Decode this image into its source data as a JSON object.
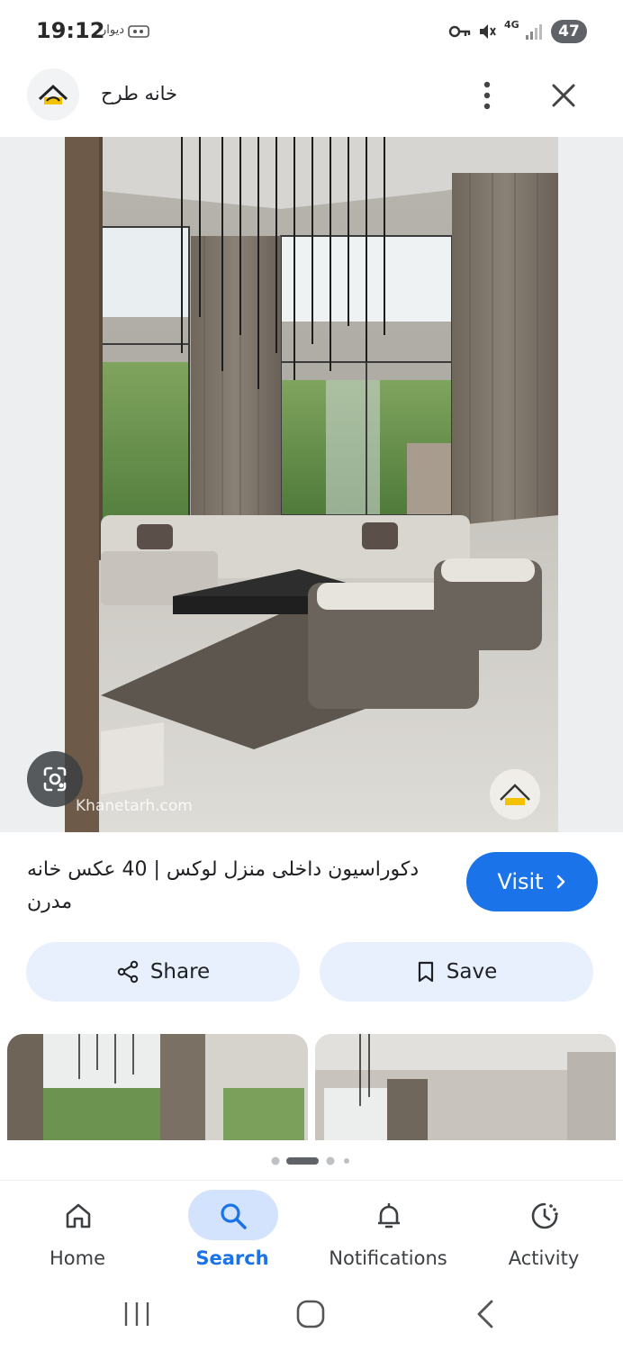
{
  "status_bar": {
    "time": "19:12",
    "app_label": "دیوار",
    "network": "4G",
    "battery": "47",
    "icons": [
      "key-icon",
      "mute-icon",
      "signal-icon"
    ]
  },
  "app_bar": {
    "site_name": "خانه طرح",
    "icons": [
      "site-logo-icon",
      "more-vert-icon",
      "close-icon"
    ]
  },
  "image": {
    "watermark": "Khanetarh.com"
  },
  "caption": "دکوراسیون داخلی منزل لوکس | 40 عکس خانه مدرن",
  "actions": {
    "visit_label": "Visit",
    "share_label": "Share",
    "save_label": "Save"
  },
  "bottom_nav": {
    "items": [
      {
        "label": "Home",
        "icon": "home-icon"
      },
      {
        "label": "Search",
        "icon": "search-icon",
        "active": true
      },
      {
        "label": "Notifications",
        "icon": "bell-icon"
      },
      {
        "label": "Activity",
        "icon": "activity-icon"
      }
    ]
  },
  "colors": {
    "accent": "#1a73e8",
    "pill_bg": "#e8f0fe",
    "nav_active_bg": "#d3e3fd"
  }
}
